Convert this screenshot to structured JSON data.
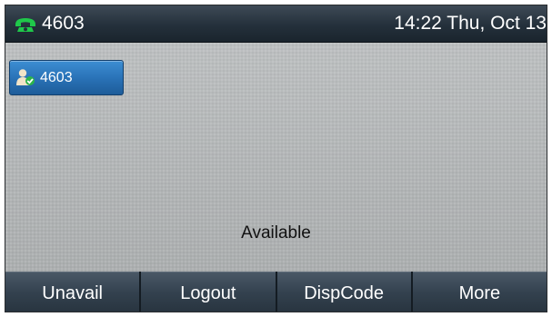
{
  "status_bar": {
    "phone_icon": "handset-icon",
    "extension": "4603",
    "datetime": "14:22 Thu, Oct 13",
    "icon_color": "#1fc84a"
  },
  "line_key": {
    "icon": "user-registered-icon",
    "label": "4603",
    "color": "#2a73b8"
  },
  "status_text": "Available",
  "softkeys": [
    {
      "label": "Unavail"
    },
    {
      "label": "Logout"
    },
    {
      "label": "DispCode"
    },
    {
      "label": "More"
    }
  ]
}
